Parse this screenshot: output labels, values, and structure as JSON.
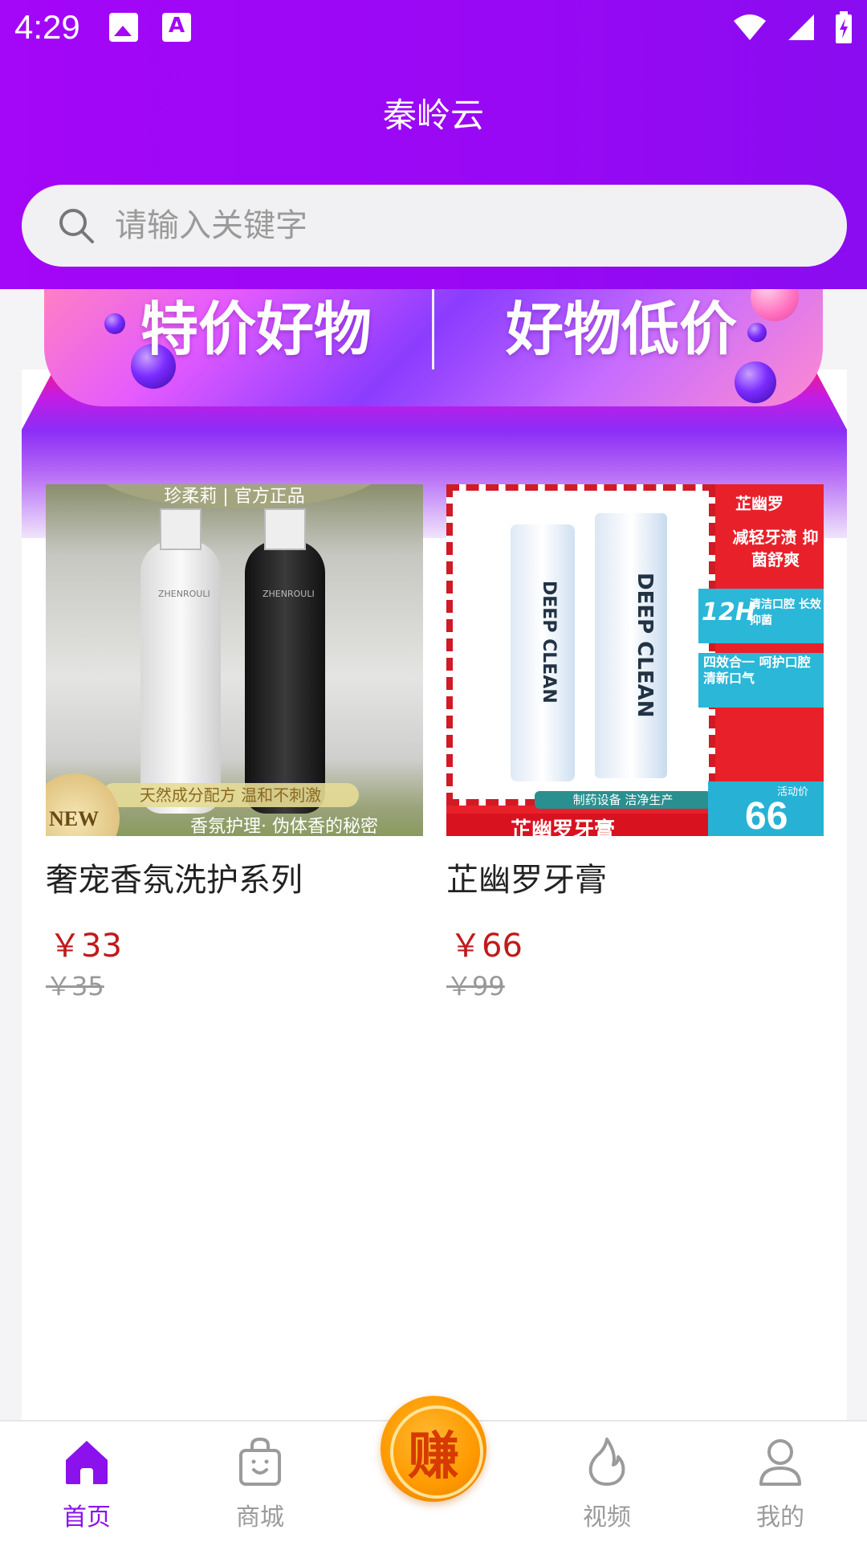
{
  "status_bar": {
    "time": "4:29"
  },
  "header": {
    "title": "秦岭云"
  },
  "search": {
    "placeholder": "请输入关键字"
  },
  "banner": {
    "left_text": "特价好物",
    "right_text": "好物低价"
  },
  "products": [
    {
      "name": "奢宠香氛洗护系列",
      "price": "￥33",
      "original_price": "￥35",
      "image_texts": {
        "top": "珍柔莉 | 官方正品",
        "tagline": "天然成分配方 温和不刺激",
        "bottom": "香氛护理· 伪体香的秘密",
        "badge": "NEW",
        "brand": "ZHENROULI"
      }
    },
    {
      "name": "芷幽罗牙膏",
      "price": "￥66",
      "original_price": "￥99",
      "image_texts": {
        "brand": "芷幽罗",
        "box_text": "DEEP CLEAN",
        "claim1": "减轻牙渍 抑菌舒爽",
        "claim2_big": "12H",
        "claim2": "清洁口腔 长效抑菌",
        "claim3": "四效合一 呵护口腔 清新口气",
        "strip": "制药设备  洁净生产",
        "promo_label": "活动价",
        "promo_value": "66",
        "bottom": "芷幽罗牙膏"
      }
    }
  ],
  "tabbar": {
    "items": [
      {
        "label": "首页",
        "icon": "home-icon",
        "active": true
      },
      {
        "label": "商城",
        "icon": "shopping-bag-icon",
        "active": false
      },
      {
        "label": "赚",
        "icon": "earn-icon",
        "active": false
      },
      {
        "label": "视频",
        "icon": "flame-icon",
        "active": false
      },
      {
        "label": "我的",
        "icon": "user-icon",
        "active": false
      }
    ]
  },
  "colors": {
    "primary": "#9b08f4",
    "price": "#c01a1a",
    "earn": "#ff9a00"
  }
}
